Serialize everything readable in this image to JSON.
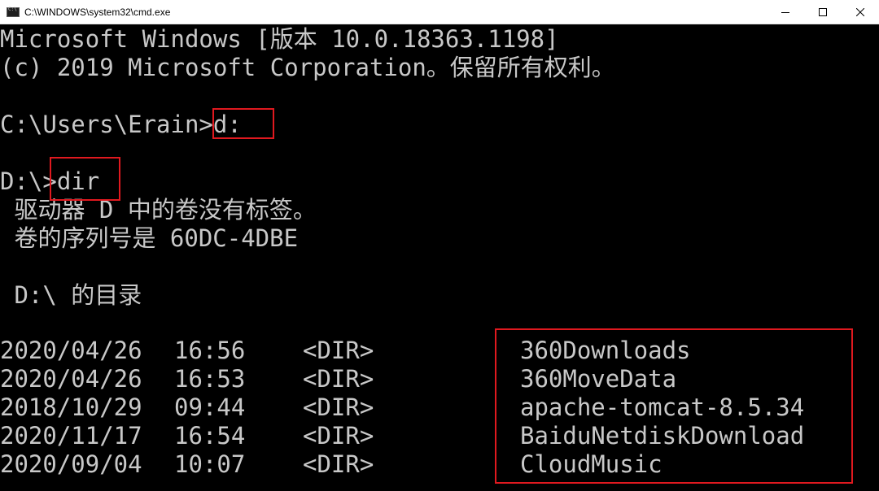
{
  "window": {
    "title": "C:\\WINDOWS\\system32\\cmd.exe",
    "icon": "console-icon"
  },
  "console": {
    "lines": [
      "Microsoft Windows [版本 10.0.18363.1198]",
      "(c) 2019 Microsoft Corporation。保留所有权利。",
      "",
      "C:\\Users\\Erain>d:",
      "",
      "D:\\>dir",
      " 驱动器 D 中的卷没有标签。",
      " 卷的序列号是 60DC-4DBE",
      "",
      " D:\\ 的目录",
      ""
    ],
    "entries": [
      {
        "date": "2020/04/26",
        "time": "16:56",
        "type": "<DIR>",
        "name": "360Downloads"
      },
      {
        "date": "2020/04/26",
        "time": "16:53",
        "type": "<DIR>",
        "name": "360MoveData"
      },
      {
        "date": "2018/10/29",
        "time": "09:44",
        "type": "<DIR>",
        "name": "apache-tomcat-8.5.34"
      },
      {
        "date": "2020/11/17",
        "time": "16:54",
        "type": "<DIR>",
        "name": "BaiduNetdiskDownload"
      },
      {
        "date": "2020/09/04",
        "time": "10:07",
        "type": "<DIR>",
        "name": "CloudMusic"
      }
    ]
  },
  "colors": {
    "background": "#000000",
    "text": "#c8c8c8",
    "highlight": "#e0191f"
  }
}
